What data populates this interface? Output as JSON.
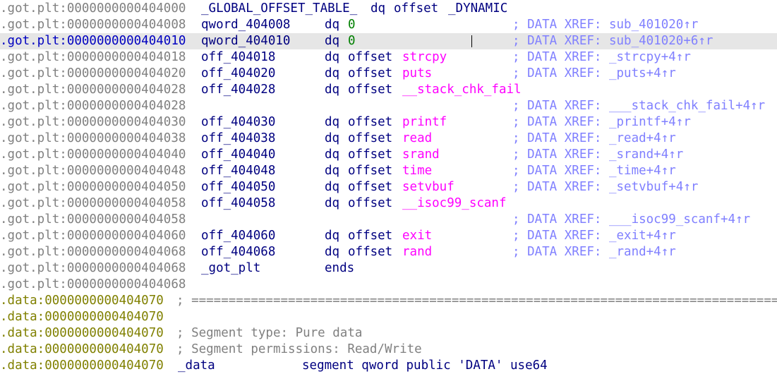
{
  "got": {
    "segment": ".got.plt",
    "lines": [
      {
        "addr": "0000000000404000",
        "label": "_GLOBAL_OFFSET_TABLE_",
        "dir": "dq",
        "off": "offset",
        "target": "_DYNAMIC",
        "target_kind": "dyn",
        "xref": ""
      },
      {
        "addr": "0000000000404008",
        "label": "qword_404008",
        "dir": "dq",
        "off": "",
        "target": "0",
        "target_kind": "zero",
        "xref": "; DATA XREF: sub_401020↑r"
      },
      {
        "addr": "0000000000404010",
        "label": "qword_404010",
        "dir": "dq",
        "off": "",
        "target": "0",
        "target_kind": "zero",
        "xref": "; DATA XREF: sub_401020+6↑r",
        "current": true
      },
      {
        "addr": "0000000000404018",
        "label": "off_404018",
        "dir": "dq",
        "off": "offset",
        "target": "strcpy",
        "target_kind": "func",
        "xref": "; DATA XREF: _strcpy+4↑r"
      },
      {
        "addr": "0000000000404020",
        "label": "off_404020",
        "dir": "dq",
        "off": "offset",
        "target": "puts",
        "target_kind": "func",
        "xref": "; DATA XREF: _puts+4↑r"
      },
      {
        "addr": "0000000000404028",
        "label": "off_404028",
        "dir": "dq",
        "off": "offset",
        "target": "__stack_chk_fail",
        "target_kind": "func",
        "xref": ""
      },
      {
        "addr": "0000000000404028",
        "label": "",
        "dir": "",
        "off": "",
        "target": "",
        "target_kind": "",
        "xref": "; DATA XREF: ___stack_chk_fail+4↑r"
      },
      {
        "addr": "0000000000404030",
        "label": "off_404030",
        "dir": "dq",
        "off": "offset",
        "target": "printf",
        "target_kind": "func",
        "xref": "; DATA XREF: _printf+4↑r"
      },
      {
        "addr": "0000000000404038",
        "label": "off_404038",
        "dir": "dq",
        "off": "offset",
        "target": "read",
        "target_kind": "func",
        "xref": "; DATA XREF: _read+4↑r"
      },
      {
        "addr": "0000000000404040",
        "label": "off_404040",
        "dir": "dq",
        "off": "offset",
        "target": "srand",
        "target_kind": "func",
        "xref": "; DATA XREF: _srand+4↑r"
      },
      {
        "addr": "0000000000404048",
        "label": "off_404048",
        "dir": "dq",
        "off": "offset",
        "target": "time",
        "target_kind": "func",
        "xref": "; DATA XREF: _time+4↑r"
      },
      {
        "addr": "0000000000404050",
        "label": "off_404050",
        "dir": "dq",
        "off": "offset",
        "target": "setvbuf",
        "target_kind": "func",
        "xref": "; DATA XREF: _setvbuf+4↑r"
      },
      {
        "addr": "0000000000404058",
        "label": "off_404058",
        "dir": "dq",
        "off": "offset",
        "target": "__isoc99_scanf",
        "target_kind": "func",
        "xref": ""
      },
      {
        "addr": "0000000000404058",
        "label": "",
        "dir": "",
        "off": "",
        "target": "",
        "target_kind": "",
        "xref": "; DATA XREF: ___isoc99_scanf+4↑r"
      },
      {
        "addr": "0000000000404060",
        "label": "off_404060",
        "dir": "dq",
        "off": "offset",
        "target": "exit",
        "target_kind": "func",
        "xref": "; DATA XREF: _exit+4↑r"
      },
      {
        "addr": "0000000000404068",
        "label": "off_404068",
        "dir": "dq",
        "off": "offset",
        "target": "rand",
        "target_kind": "func",
        "xref": "; DATA XREF: _rand+4↑r"
      },
      {
        "addr": "0000000000404068",
        "label": "_got_plt",
        "dir": "ends",
        "off": "",
        "target": "",
        "target_kind": "",
        "xref": ""
      },
      {
        "addr": "0000000000404068",
        "label": "",
        "dir": "",
        "off": "",
        "target": "",
        "target_kind": "",
        "xref": ""
      }
    ]
  },
  "data": {
    "segment": ".data",
    "lines": [
      {
        "addr": "0000000000404070",
        "text": "; ================================================================================",
        "kind": "comment"
      },
      {
        "addr": "0000000000404070",
        "text": "",
        "kind": "empty"
      },
      {
        "addr": "0000000000404070",
        "text": "; Segment type: Pure data",
        "kind": "comment"
      },
      {
        "addr": "0000000000404070",
        "text": "; Segment permissions: Read/Write",
        "kind": "comment"
      },
      {
        "addr": "0000000000404070",
        "text": "",
        "kind": "segdef",
        "label": "_data",
        "directive": "segment qword public 'DATA' use64"
      }
    ]
  },
  "colors": {
    "background": "#ffffff",
    "highlight": "#e6e6e6",
    "got_segment": "#808080",
    "data_segment": "#808000",
    "label": "#000080",
    "import": "#ff00ff",
    "zero": "#008000",
    "xref_comment": "#8080ff"
  }
}
